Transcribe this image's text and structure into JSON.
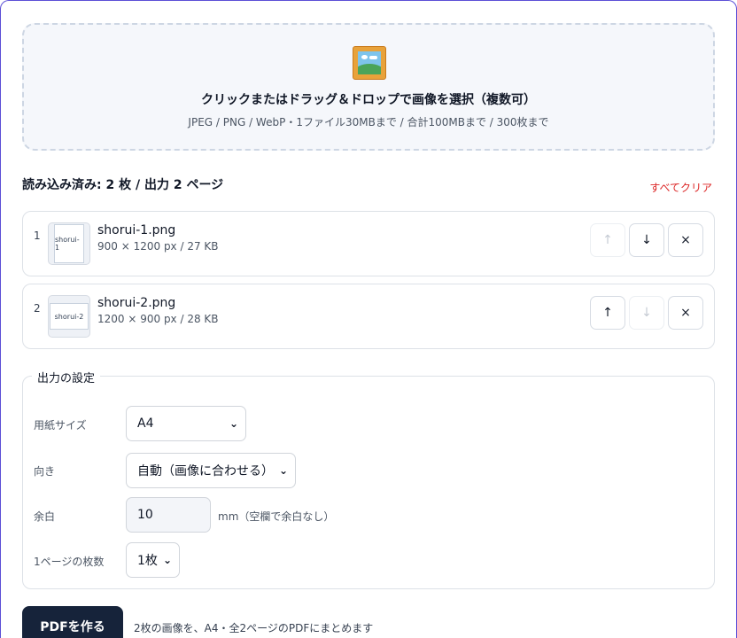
{
  "dropzone": {
    "icon": "framed-picture-icon",
    "title": "クリックまたはドラッグ＆ドロップで画像を選択（複数可）",
    "hint": "JPEG / PNG / WebP・1ファイル30MBまで / 合計100MBまで / 300枚まで"
  },
  "summary": "読み込み済み: 2 枚 / 出力 2 ページ",
  "clear_all_label": "すべてクリア",
  "files": [
    {
      "index": "1",
      "thumb_label": "shorui-1",
      "name": "shorui-1.png",
      "meta": "900 × 1200 px / 27 KB",
      "up": "↑",
      "down": "↓",
      "remove": "×"
    },
    {
      "index": "2",
      "thumb_label": "shorui-2",
      "name": "shorui-2.png",
      "meta": "1200 × 900 px / 28 KB",
      "up": "↑",
      "down": "↓",
      "remove": "×"
    }
  ],
  "settings": {
    "legend": "出力の設定",
    "paper_size": {
      "label": "用紙サイズ",
      "value": "A4"
    },
    "orientation": {
      "label": "向き",
      "value": "自動（画像に合わせる）"
    },
    "margin": {
      "label": "余白",
      "value": "10",
      "unit": "mm（空欄で余白なし）"
    },
    "per_page": {
      "label": "1ページの枚数",
      "value": "1枚"
    }
  },
  "make_button_label": "PDFを作る",
  "make_note": "2枚の画像を、A4・全2ページのPDFにまとめます"
}
